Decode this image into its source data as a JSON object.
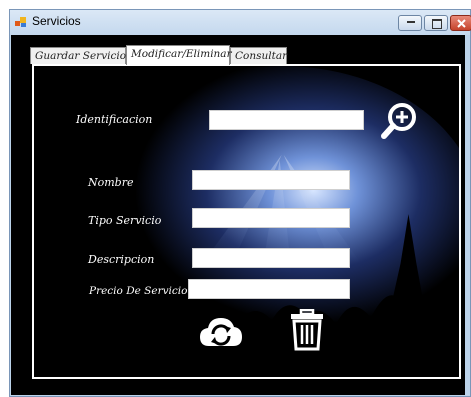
{
  "window": {
    "title": "Servicios"
  },
  "tabs": [
    {
      "label": "Guardar Servicio",
      "active": false
    },
    {
      "label": "Modificar/Eliminar",
      "active": true
    },
    {
      "label": "Consultar",
      "active": false
    }
  ],
  "form": {
    "identificacion": {
      "label": "Identificacion",
      "value": ""
    },
    "nombre": {
      "label": "Nombre",
      "value": ""
    },
    "tipo_servicio": {
      "label": "Tipo Servicio",
      "value": ""
    },
    "descripcion": {
      "label": "Descripcion",
      "value": ""
    },
    "precio": {
      "label": "Precio De Servicio",
      "value": ""
    }
  },
  "icons": {
    "search": "zoom-plus-icon",
    "update": "cloud-refresh-icon",
    "delete": "trash-icon"
  }
}
